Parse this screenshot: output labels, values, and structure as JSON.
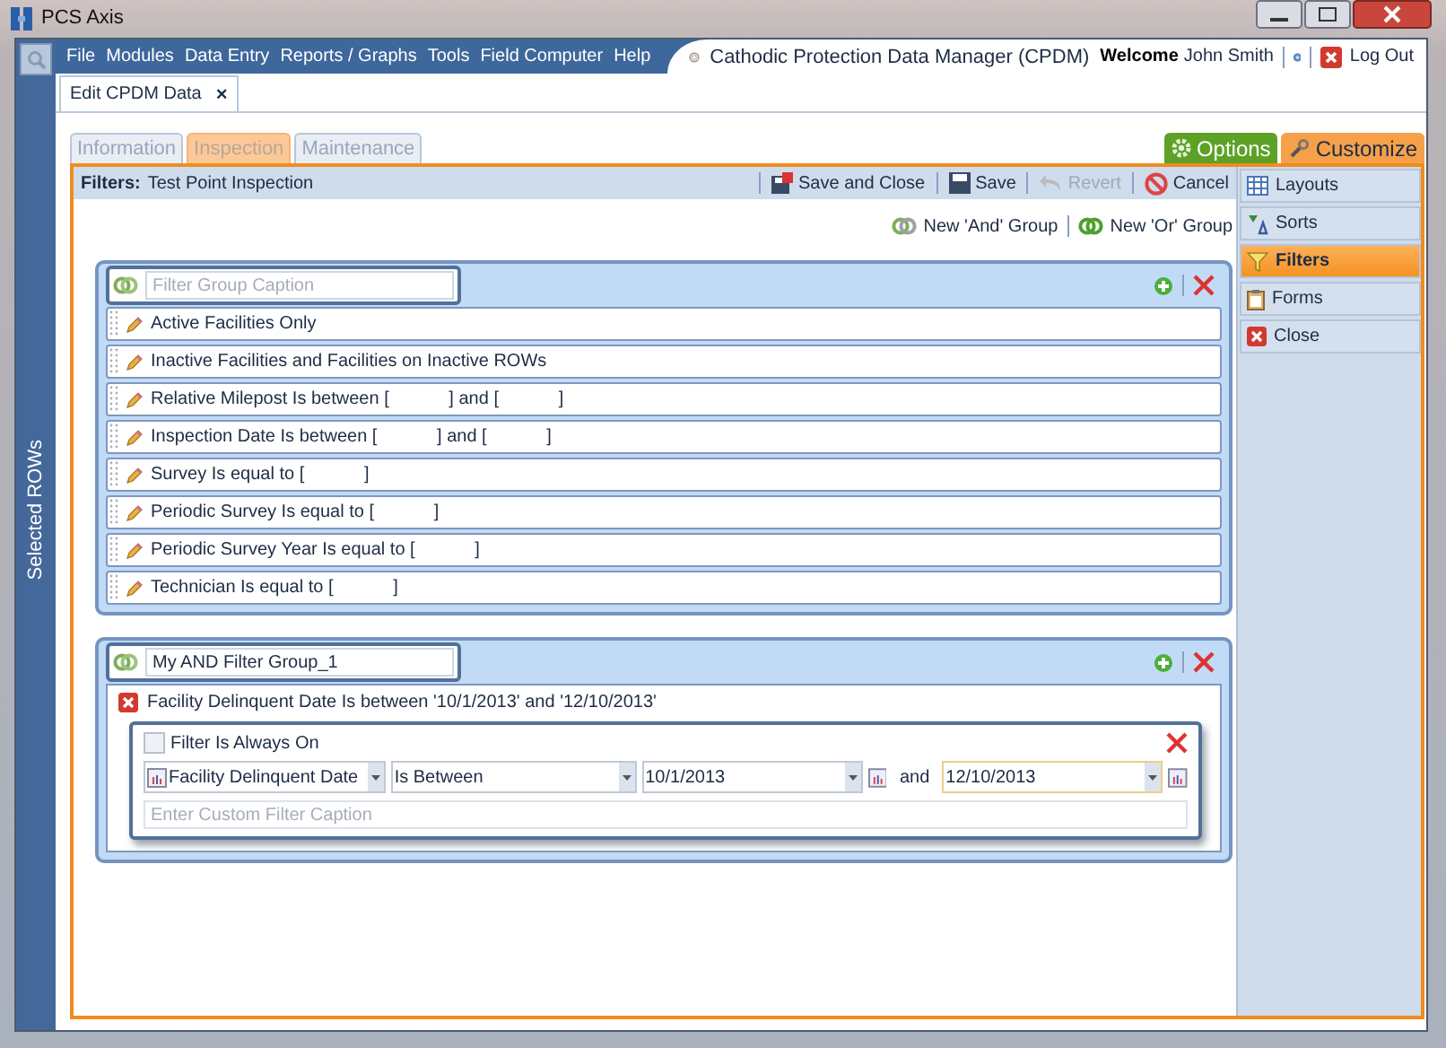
{
  "window": {
    "title": "PCS Axis"
  },
  "menu": [
    "File",
    "Modules",
    "Data Entry",
    "Reports / Graphs",
    "Tools",
    "Field Computer",
    "Help"
  ],
  "app_title": "Cathodic Protection Data Manager (CPDM)",
  "user": {
    "welcome": "Welcome",
    "name": "John Smith",
    "logout": "Log Out"
  },
  "sidebar": {
    "label": "Selected ROWs"
  },
  "document_tabs": [
    {
      "label": "Edit CPDM Data",
      "close": "×"
    }
  ],
  "sub_tabs": [
    {
      "label": "Information",
      "selected": false
    },
    {
      "label": "Inspection",
      "selected": true
    },
    {
      "label": "Maintenance",
      "selected": false
    }
  ],
  "option_tabs": [
    {
      "label": "Options",
      "kind": "options"
    },
    {
      "label": "Customize",
      "kind": "customize"
    }
  ],
  "filters_bar": {
    "label": "Filters:",
    "value": "Test Point Inspection"
  },
  "toolbar": [
    {
      "label": "Save and Close",
      "kind": "saveclose",
      "disabled": false
    },
    {
      "label": "Save",
      "kind": "save",
      "disabled": false
    },
    {
      "label": "Revert",
      "kind": "revert",
      "disabled": true
    },
    {
      "label": "Cancel",
      "kind": "cancel",
      "disabled": false
    }
  ],
  "group_actions": [
    {
      "label": "New 'And' Group",
      "kind": "and"
    },
    {
      "label": "New 'Or' Group",
      "kind": "or"
    }
  ],
  "groups": [
    {
      "placeholder": "Filter Group Caption",
      "filters": [
        {
          "text": "Active Facilities Only"
        },
        {
          "text": "Inactive Facilities and Facilities on Inactive ROWs"
        },
        {
          "text": "Relative Milepost Is between [            ] and [            ]"
        },
        {
          "text": "Inspection Date Is between [            ] and [            ]"
        },
        {
          "text": "Survey Is equal to [            ]"
        },
        {
          "text": "Periodic Survey Is equal to [            ]"
        },
        {
          "text": "Periodic Survey Year Is equal to [            ]"
        },
        {
          "text": "Technician Is equal to [            ]"
        }
      ]
    },
    {
      "caption": "My AND Filter Group_1",
      "active_filter": {
        "text": "Facility Delinquent Date Is between '10/1/2013' and '12/10/2013'",
        "editor": {
          "always_on": {
            "label": "Filter Is Always On",
            "checked": false
          },
          "field": "Facility Delinquent Date",
          "operator": "Is Between",
          "from": "10/1/2013",
          "joiner": "and",
          "to": "12/10/2013",
          "caption_placeholder": "Enter Custom Filter Caption"
        }
      }
    }
  ],
  "side_panel": [
    {
      "label": "Layouts",
      "kind": "layouts",
      "selected": false
    },
    {
      "label": "Sorts",
      "kind": "sorts",
      "selected": false
    },
    {
      "label": "Filters",
      "kind": "filters",
      "selected": true
    },
    {
      "label": "Forms",
      "kind": "forms",
      "selected": false
    },
    {
      "label": "Close",
      "kind": "close",
      "selected": false
    }
  ]
}
